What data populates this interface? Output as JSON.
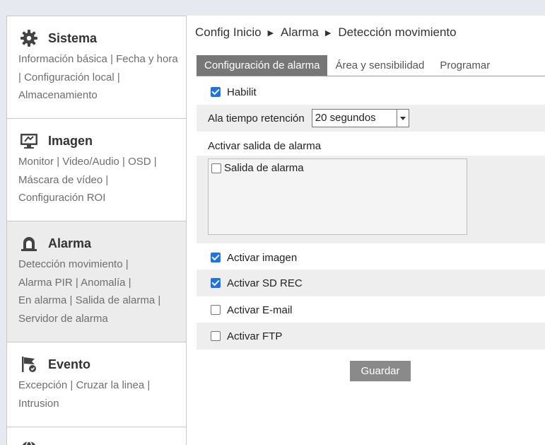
{
  "sidebar": {
    "sections": [
      {
        "title": "Sistema",
        "icon": "gear-icon",
        "links": [
          "Información básica",
          "Fecha y hora",
          "Configuración local",
          "Almacenamiento"
        ]
      },
      {
        "title": "Imagen",
        "icon": "monitor-icon",
        "links": [
          "Monitor",
          "Video/Audio",
          "OSD",
          "Máscara de vídeo",
          "Configuración ROI"
        ]
      },
      {
        "title": "Alarma",
        "icon": "alarm-bell-icon",
        "links": [
          "Detección movimiento",
          "Alarma PIR",
          "Anomalía",
          "En alarma",
          "Salida de alarma",
          "Servidor de alarma"
        ]
      },
      {
        "title": "Evento",
        "icon": "event-flag-icon",
        "links": [
          "Excepción",
          "Cruzar la linea",
          "Intrusion"
        ]
      },
      {
        "title": "",
        "icon": "globe-icon",
        "links": []
      }
    ]
  },
  "breadcrumb": [
    "Config Inicio",
    "Alarma",
    "Detección movimiento"
  ],
  "tabs": [
    "Configuración de alarma",
    "Área y sensibilidad",
    "Programar"
  ],
  "form": {
    "enable_label": "Habilit",
    "enable_checked": true,
    "retention_label": "Ala tiempo retención",
    "retention_value": "20 segundos",
    "output_label": "Activar salida de alarma",
    "output_item_label": "Salida de alarma",
    "output_item_checked": false,
    "snapshot_label": "Activar imagen",
    "snapshot_checked": true,
    "sd_rec_label": "Activar SD REC",
    "sd_rec_checked": true,
    "email_label": "Activar E-mail",
    "email_checked": false,
    "ftp_label": "Activar FTP",
    "ftp_checked": false
  },
  "save_label": "Guardar",
  "colors": {
    "accent_tab": "#777777",
    "checkbox_on": "#1a73e8",
    "button": "#8a8a8a"
  }
}
